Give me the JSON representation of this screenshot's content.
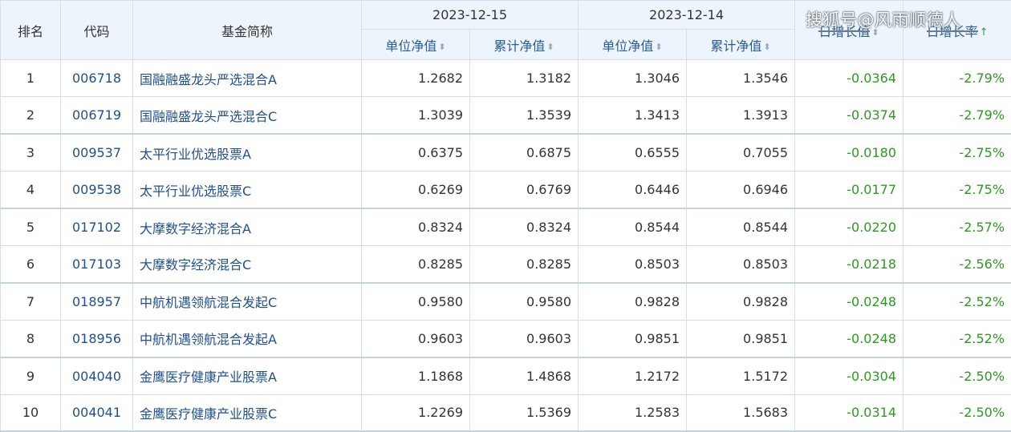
{
  "header": {
    "rank": "排名",
    "code": "代码",
    "name": "基金简称",
    "date1": "2023-12-15",
    "date2": "2023-12-14",
    "unit_nav": "单位净值",
    "acc_nav": "累计净值",
    "daily_growth_value": "日增长值",
    "daily_growth_rate": "日增长率"
  },
  "watermark": "搜狐号@风雨顺德人",
  "icons": {
    "sort": "sort-icon",
    "sort_active": "sort-up-arrow-icon",
    "accent_green": "#2b9a1f",
    "link_blue": "#1f4f8f"
  },
  "rows": [
    {
      "rank": "1",
      "code": "006718",
      "name": "国融融盛龙头严选混合A",
      "nav1": "1.2682",
      "acc1": "1.3182",
      "nav2": "1.3046",
      "acc2": "1.3546",
      "growth": "-0.0364",
      "rate": "-2.79%"
    },
    {
      "rank": "2",
      "code": "006719",
      "name": "国融融盛龙头严选混合C",
      "nav1": "1.3039",
      "acc1": "1.3539",
      "nav2": "1.3413",
      "acc2": "1.3913",
      "growth": "-0.0374",
      "rate": "-2.79%"
    },
    {
      "rank": "3",
      "code": "009537",
      "name": "太平行业优选股票A",
      "nav1": "0.6375",
      "acc1": "0.6875",
      "nav2": "0.6555",
      "acc2": "0.7055",
      "growth": "-0.0180",
      "rate": "-2.75%"
    },
    {
      "rank": "4",
      "code": "009538",
      "name": "太平行业优选股票C",
      "nav1": "0.6269",
      "acc1": "0.6769",
      "nav2": "0.6446",
      "acc2": "0.6946",
      "growth": "-0.0177",
      "rate": "-2.75%"
    },
    {
      "rank": "5",
      "code": "017102",
      "name": "大摩数字经济混合A",
      "nav1": "0.8324",
      "acc1": "0.8324",
      "nav2": "0.8544",
      "acc2": "0.8544",
      "growth": "-0.0220",
      "rate": "-2.57%"
    },
    {
      "rank": "6",
      "code": "017103",
      "name": "大摩数字经济混合C",
      "nav1": "0.8285",
      "acc1": "0.8285",
      "nav2": "0.8503",
      "acc2": "0.8503",
      "growth": "-0.0218",
      "rate": "-2.56%"
    },
    {
      "rank": "7",
      "code": "018957",
      "name": "中航机遇领航混合发起C",
      "nav1": "0.9580",
      "acc1": "0.9580",
      "nav2": "0.9828",
      "acc2": "0.9828",
      "growth": "-0.0248",
      "rate": "-2.52%"
    },
    {
      "rank": "8",
      "code": "018956",
      "name": "中航机遇领航混合发起A",
      "nav1": "0.9603",
      "acc1": "0.9603",
      "nav2": "0.9851",
      "acc2": "0.9851",
      "growth": "-0.0248",
      "rate": "-2.52%"
    },
    {
      "rank": "9",
      "code": "004040",
      "name": "金鹰医疗健康产业股票A",
      "nav1": "1.1868",
      "acc1": "1.4868",
      "nav2": "1.2172",
      "acc2": "1.5172",
      "growth": "-0.0304",
      "rate": "-2.50%"
    },
    {
      "rank": "10",
      "code": "004041",
      "name": "金鹰医疗健康产业股票C",
      "nav1": "1.2269",
      "acc1": "1.5369",
      "nav2": "1.2583",
      "acc2": "1.5683",
      "growth": "-0.0314",
      "rate": "-2.50%"
    }
  ]
}
